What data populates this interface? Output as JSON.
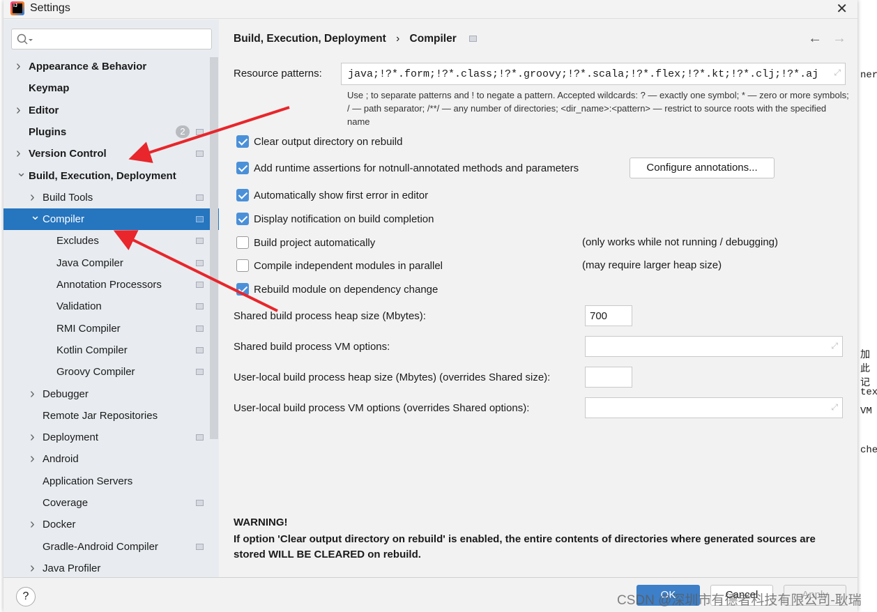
{
  "window": {
    "title": "Settings"
  },
  "sidebar": {
    "items": [
      {
        "label": "Appearance & Behavior",
        "level": 0,
        "arrow": ">",
        "bold": true
      },
      {
        "label": "Keymap",
        "level": 0,
        "bold": true
      },
      {
        "label": "Editor",
        "level": 0,
        "arrow": ">",
        "bold": true
      },
      {
        "label": "Plugins",
        "level": 0,
        "bold": true,
        "badge": "2",
        "gear": true
      },
      {
        "label": "Version Control",
        "level": 0,
        "arrow": ">",
        "bold": true,
        "gear": true
      },
      {
        "label": "Build, Execution, Deployment",
        "level": 0,
        "arrow": "v",
        "bold": true
      },
      {
        "label": "Build Tools",
        "level": 1,
        "arrow": ">",
        "gear": true
      },
      {
        "label": "Compiler",
        "level": 1,
        "arrow": "v",
        "gear": true,
        "selected": true
      },
      {
        "label": "Excludes",
        "level": 2,
        "gear": true
      },
      {
        "label": "Java Compiler",
        "level": 2,
        "gear": true
      },
      {
        "label": "Annotation Processors",
        "level": 2,
        "gear": true
      },
      {
        "label": "Validation",
        "level": 2,
        "gear": true
      },
      {
        "label": "RMI Compiler",
        "level": 2,
        "gear": true
      },
      {
        "label": "Kotlin Compiler",
        "level": 2,
        "gear": true
      },
      {
        "label": "Groovy Compiler",
        "level": 2,
        "gear": true
      },
      {
        "label": "Debugger",
        "level": 1,
        "arrow": ">"
      },
      {
        "label": "Remote Jar Repositories",
        "level": 1
      },
      {
        "label": "Deployment",
        "level": 1,
        "arrow": ">",
        "gear": true
      },
      {
        "label": "Android",
        "level": 1,
        "arrow": ">"
      },
      {
        "label": "Application Servers",
        "level": 1
      },
      {
        "label": "Coverage",
        "level": 1,
        "gear": true
      },
      {
        "label": "Docker",
        "level": 1,
        "arrow": ">"
      },
      {
        "label": "Gradle-Android Compiler",
        "level": 1,
        "gear": true
      },
      {
        "label": "Java Profiler",
        "level": 1,
        "arrow": ">"
      }
    ]
  },
  "breadcrumb": {
    "parent": "Build, Execution, Deployment",
    "sep": "›",
    "current": "Compiler"
  },
  "resource": {
    "label": "Resource patterns:",
    "value": "java;!?*.form;!?*.class;!?*.groovy;!?*.scala;!?*.flex;!?*.kt;!?*.clj;!?*.aj",
    "hint": "Use ; to separate patterns and ! to negate a pattern. Accepted wildcards: ? — exactly one symbol; * — zero or more symbols; / — path separator; /**/ — any number of directories; <dir_name>:<pattern> — restrict to source roots with the specified name"
  },
  "options": [
    {
      "label": "Clear output directory on rebuild",
      "checked": true
    },
    {
      "label": "Add runtime assertions for notnull-annotated methods and parameters",
      "checked": true
    },
    {
      "label": "Automatically show first error in editor",
      "checked": true
    },
    {
      "label": "Display notification on build completion",
      "checked": true
    },
    {
      "label": "Build project automatically",
      "checked": false,
      "note": "(only works while not running / debugging)"
    },
    {
      "label": "Compile independent modules in parallel",
      "checked": false,
      "note": "(may require larger heap size)"
    },
    {
      "label": "Rebuild module on dependency change",
      "checked": true
    }
  ],
  "configure_button": "Configure annotations...",
  "fields": [
    {
      "label": "Shared build process heap size (Mbytes):",
      "value": "700"
    },
    {
      "label": "Shared build process VM options:",
      "value": ""
    },
    {
      "label": "User-local build process heap size (Mbytes) (overrides Shared size):",
      "value": ""
    },
    {
      "label": "User-local build process VM options (overrides Shared options):",
      "value": ""
    }
  ],
  "warning": {
    "title": "WARNING!",
    "text": "If option 'Clear output directory on rebuild' is enabled, the entire contents of directories where generated sources are stored WILL BE CLEARED on rebuild."
  },
  "footer": {
    "help": "?",
    "ok": "OK",
    "cancel": "Cancel",
    "apply": "Apply"
  },
  "watermark": "CSDN @深圳市有德者科技有限公司-耿瑞",
  "background_fragments": [
    "ner",
    "加此记",
    "tex",
    "VM",
    "che"
  ],
  "colors": {
    "selection": "#2675bf",
    "checkbox": "#4a90d9",
    "annotation_arrows": "#e8262b"
  }
}
